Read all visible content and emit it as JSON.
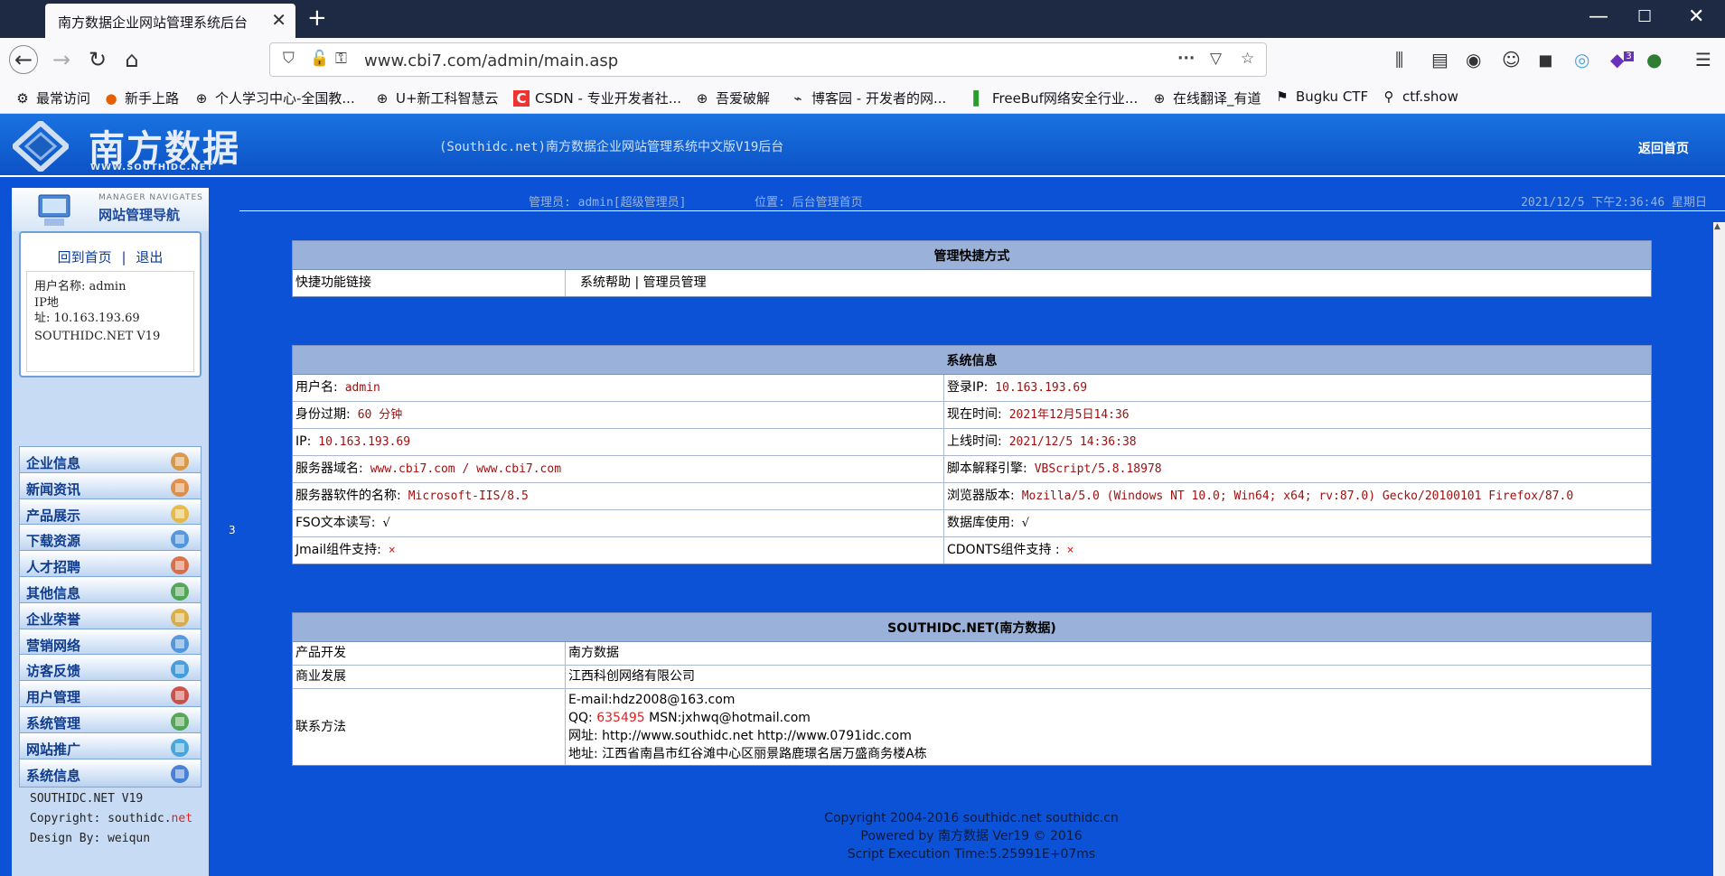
{
  "browser": {
    "tab_title": "南方数据企业网站管理系统后台",
    "url": "www.cbi7.com/admin/main.asp",
    "extension_badge": "3",
    "bookmarks": [
      "最常访问",
      "新手上路",
      "个人学习中心-全国教...",
      "U+新工科智慧云",
      "CSDN - 专业开发者社...",
      "吾爱破解",
      "博客园 - 开发者的网...",
      "FreeBuf网络安全行业...",
      "在线翻译_有道",
      "Bugku CTF",
      "ctf.show"
    ]
  },
  "header": {
    "logo_text": "南方数据",
    "logo_url": "WWW.SOUTHIDC.NET",
    "title": "(Southidc.net)南方数据企业网站管理系统中文版V19后台",
    "home_link": "返回首页"
  },
  "sidebar": {
    "nav_en": "MANAGER NAVIGATES",
    "nav_cn": "网站管理导航",
    "link_home": "回到首页",
    "link_sep": "|",
    "link_logout": "退出",
    "username_line": "用户名称: admin",
    "ip_label": "IP地",
    "ip_line": "址: 10.163.193.69",
    "version": "SOUTHIDC.NET V19",
    "items": [
      "企业信息",
      "新闻资讯",
      "产品展示",
      "下载资源",
      "人才招聘",
      "其他信息",
      "企业荣誉",
      "营销网络",
      "访客反馈",
      "用户管理",
      "系统管理",
      "网站推广",
      "系统信息"
    ],
    "footer_version": "SOUTHIDC.NET V19",
    "footer_copy_label": "Copyright: southidc.",
    "footer_copy_net": "net",
    "footer_design": "Design By:  weiqun",
    "splitter_label": "3"
  },
  "topbar": {
    "admin": "管理员: admin[超级管理员]",
    "position": "位置: 后台管理首页",
    "time": "2021/12/5 下午2:36:46 星期日"
  },
  "shortcuts": {
    "title": "管理快捷方式",
    "label": "快捷功能链接",
    "links": "系统帮助 | 管理员管理"
  },
  "sysinfo": {
    "title": "系统信息",
    "rows": [
      {
        "l_label": "用户名:",
        "l_val": "admin",
        "r_label": "登录IP:",
        "r_val": "10.163.193.69"
      },
      {
        "l_label": "身份过期:",
        "l_val": "60 分钟",
        "r_label": "现在时间:",
        "r_val": "2021年12月5日14:36"
      },
      {
        "l_label": "IP:",
        "l_val": "10.163.193.69",
        "r_label": "上线时间:",
        "r_val": "2021/12/5 14:36:38"
      },
      {
        "l_label": "服务器域名:",
        "l_val": "www.cbi7.com / www.cbi7.com",
        "r_label": "脚本解释引擎:",
        "r_val": "VBScript/5.8.18978"
      },
      {
        "l_label": "服务器软件的名称:",
        "l_val": "Microsoft-IIS/8.5",
        "r_label": "浏览器版本:",
        "r_val": "Mozilla/5.0 (Windows NT 10.0; Win64; x64; rv:87.0) Gecko/20100101 Firefox/87.0"
      },
      {
        "l_label": "FSO文本读写:",
        "l_val": "√",
        "r_label": "数据库使用:",
        "r_val": "√"
      },
      {
        "l_label": "Jmail组件支持:",
        "l_val": "×",
        "r_label": "CDONTS组件支持 :",
        "r_val": "×"
      }
    ]
  },
  "about": {
    "title": "SOUTHIDC.NET(南方数据)",
    "dev_label": "产品开发",
    "dev_val": "南方数据",
    "biz_label": "商业发展",
    "biz_val": "江西科创网络有限公司",
    "contact_label": "联系方法",
    "email": "E-mail:hdz2008@163.com",
    "qq_label": "QQ:",
    "qq_num": "635495",
    "msn": "MSN:jxhwq@hotmail.com",
    "site": "网址: http://www.southidc.net http://www.0791idc.com",
    "address": "地址: 江西省南昌市红谷滩中心区丽景路鹿璟名居万盛商务楼A栋"
  },
  "footer": {
    "line1": "Copyright 2004-2016 southidc.net southidc.cn",
    "line2": "Powered by 南方数据 Ver19 © 2016",
    "line3": "Script Execution Time:5.25991E+07ms"
  }
}
